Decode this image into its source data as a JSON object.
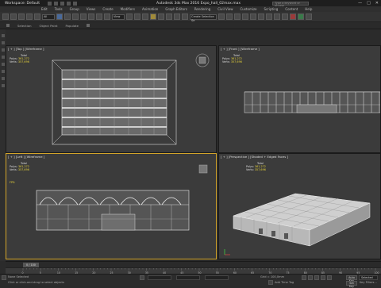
{
  "title_bar": {
    "workspace": "Workspace: Default",
    "title": "Autodesk 3ds Max 2016    Expo_hall_02max.max",
    "search_placeholder": "Type a keyword or phrase",
    "minimize": "—",
    "maximize": "□",
    "close": "✕"
  },
  "menu": {
    "items": [
      "Edit",
      "Tools",
      "Group",
      "Views",
      "Create",
      "Modifiers",
      "Animation",
      "Graph Editors",
      "Rendering",
      "Civil View",
      "Customize",
      "Scripting",
      "Content",
      "Help"
    ]
  },
  "toolbar": {
    "selection_filter": "All",
    "reference_coord": "View",
    "named_selection": "Create Selection Se"
  },
  "ribbon": {
    "items": [
      "Selection",
      "Object Paint",
      "Populate"
    ]
  },
  "viewports": {
    "top": {
      "label": "[ + ] [Top ] [Wireframe ]"
    },
    "front": {
      "label": "[ + ] [Front ] [Wireframe ]"
    },
    "left": {
      "label": "[ + ] [Left ] [Wireframe ]"
    },
    "perspective": {
      "label": "[ + ] [Perspective ] [Shaded + Edged Faces ]"
    }
  },
  "stats": {
    "total_label": "Total",
    "polys_label": "Polys:",
    "polys_value": "361,272",
    "verts_label": "Verts:",
    "verts_value": "357,696",
    "fps_label": "FPS:"
  },
  "timeline": {
    "frame_display": "0 / 100",
    "ruler_ticks": [
      "0",
      "5",
      "10",
      "15",
      "20",
      "25",
      "30",
      "35",
      "40",
      "45",
      "50",
      "55",
      "60",
      "65",
      "70",
      "75",
      "80",
      "85",
      "90",
      "95",
      "100"
    ]
  },
  "status_bar": {
    "selection": "None Selected",
    "prompt": "Click or click-and-drag to select objects",
    "grid": "Grid = 100,0mm",
    "auto_key": "Auto Key",
    "set_key": "Set Key",
    "selected": "Selected",
    "add_time_tag": "Add Time Tag",
    "key_filters": "Key Filters..."
  },
  "colors": {
    "active_viewport_border": "#d4a52a",
    "stats_highlight": "#e6d23a",
    "viewport_bg": "#3b3b3b",
    "wireframe": "#e8e8e8"
  }
}
